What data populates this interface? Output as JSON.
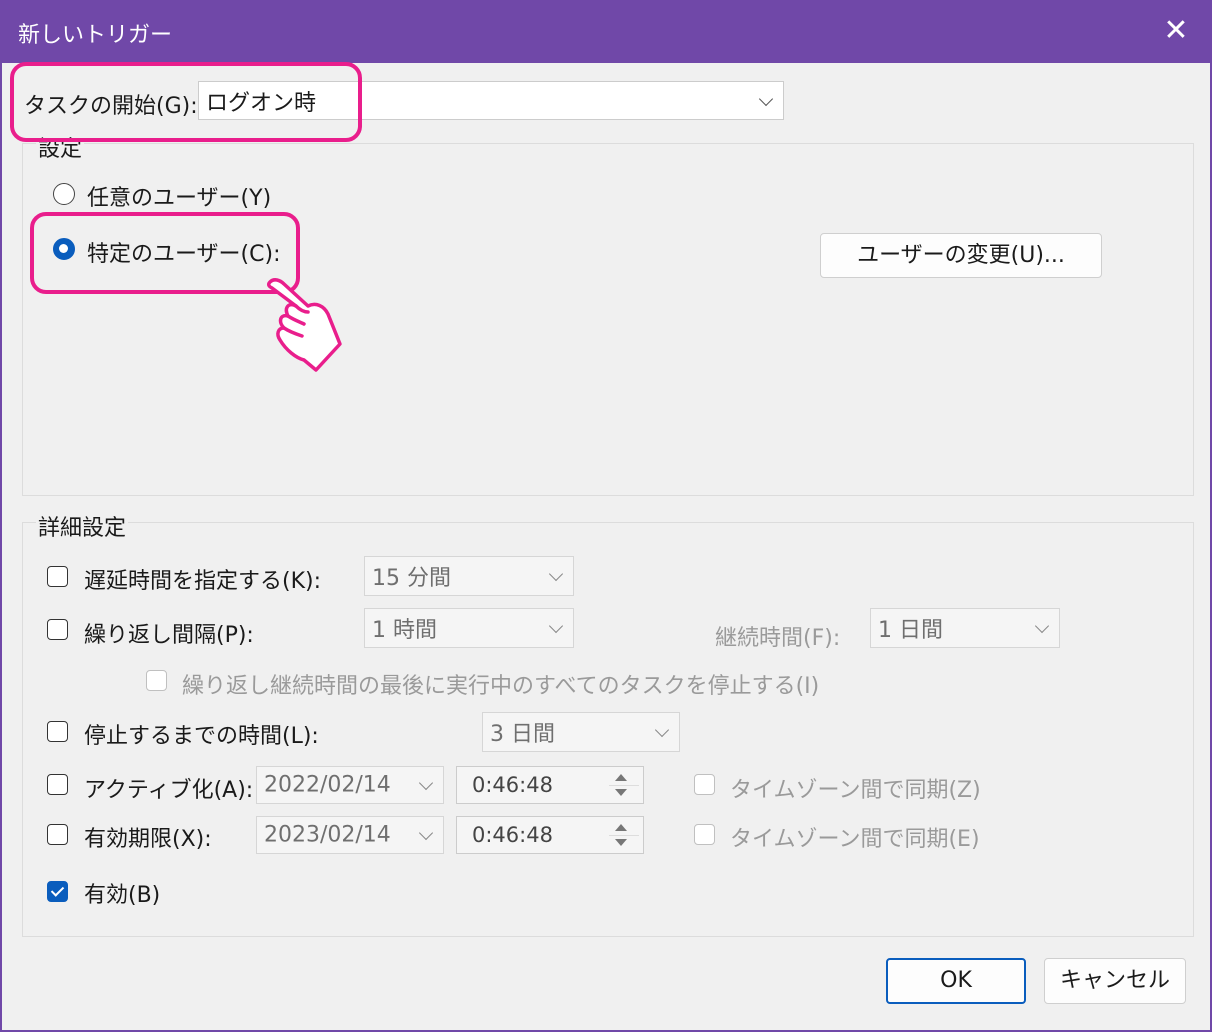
{
  "window": {
    "title": "新しいトリガー",
    "close_glyph": "✕"
  },
  "task_start": {
    "label": "タスクの開始(G):",
    "value": "ログオン時"
  },
  "settings": {
    "group_label": "設定",
    "radio_any_user": "任意のユーザー(Y)",
    "radio_specific_user": "特定のユーザー(C):",
    "selected": "specific_user",
    "change_user_button": "ユーザーの変更(U)..."
  },
  "advanced": {
    "group_label": "詳細設定",
    "delay": {
      "label": "遅延時間を指定する(K):",
      "checked": false,
      "value": "15 分間"
    },
    "repeat": {
      "label": "繰り返し間隔(P):",
      "checked": false,
      "value": "1 時間",
      "duration_label": "継続時間(F):",
      "duration_value": "1 日間"
    },
    "stop_all": {
      "label": "繰り返し継続時間の最後に実行中のすべてのタスクを停止する(I)",
      "checked": false
    },
    "stop_after": {
      "label": "停止するまでの時間(L):",
      "checked": false,
      "value": "3 日間"
    },
    "activate": {
      "label": "アクティブ化(A):",
      "checked": false,
      "date": "2022/02/14",
      "time": "0:46:48",
      "sync_label": "タイムゾーン間で同期(Z)"
    },
    "expire": {
      "label": "有効期限(X):",
      "checked": false,
      "date": "2023/02/14",
      "time": "0:46:48",
      "sync_label": "タイムゾーン間で同期(E)"
    },
    "enabled": {
      "label": "有効(B)",
      "checked": true
    }
  },
  "footer": {
    "ok": "OK",
    "cancel": "キャンセル"
  },
  "colors": {
    "titlebar": "#7048a8",
    "highlight": "#e91e8c",
    "accent": "#0a5dbd"
  },
  "annotations": {
    "pointer_icon": "pointing-hand-icon"
  }
}
